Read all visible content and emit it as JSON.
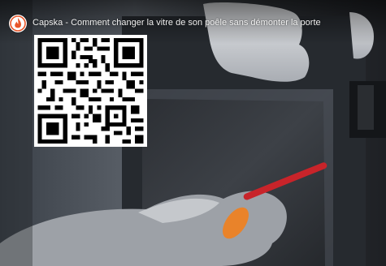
{
  "video": {
    "title": "Capska - Comment changer la vitre de son poêle sans démonter la porte"
  },
  "channel": {
    "logo_icon": "capska-flame-logo-icon",
    "accent": "#e8562a"
  },
  "overlay": {
    "qr_icon": "qr-code-icon"
  },
  "colors": {
    "glove": "#d6d8dc",
    "screwdriver_handle": "#e9832a",
    "screwdriver_shaft": "#c8242a",
    "stove_frame": "#2a2d31"
  }
}
